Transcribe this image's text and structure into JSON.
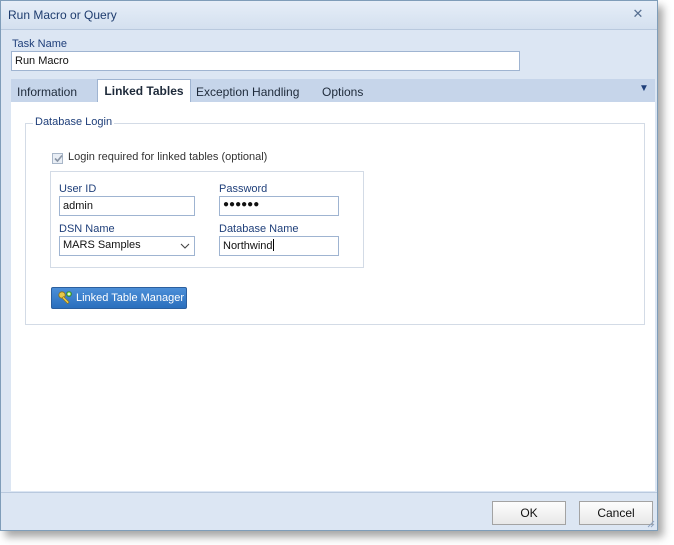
{
  "window": {
    "title": "Run Macro or Query"
  },
  "task": {
    "label": "Task Name",
    "value": "Run Macro"
  },
  "tabs": [
    {
      "label": "Information",
      "active": false
    },
    {
      "label": "Linked Tables",
      "active": true
    },
    {
      "label": "Exception Handling",
      "active": false
    },
    {
      "label": "Options",
      "active": false
    }
  ],
  "database_login": {
    "group_title": "Database Login",
    "checkbox_label": "Login required for linked tables (optional)",
    "checkbox_checked": true,
    "user_id": {
      "label": "User ID",
      "value": "admin"
    },
    "password": {
      "label": "Password",
      "value": "●●●●●●"
    },
    "dsn_name": {
      "label": "DSN Name",
      "value": "MARS Samples"
    },
    "database_name": {
      "label": "Database Name",
      "value": "Northwind"
    }
  },
  "linked_table_manager": {
    "label": "Linked Table Manager"
  },
  "buttons": {
    "ok": "OK",
    "cancel": "Cancel"
  },
  "colors": {
    "accent": "#2a6fbd",
    "title_text": "#1e3c6e",
    "label_text": "#1f3f7a"
  }
}
